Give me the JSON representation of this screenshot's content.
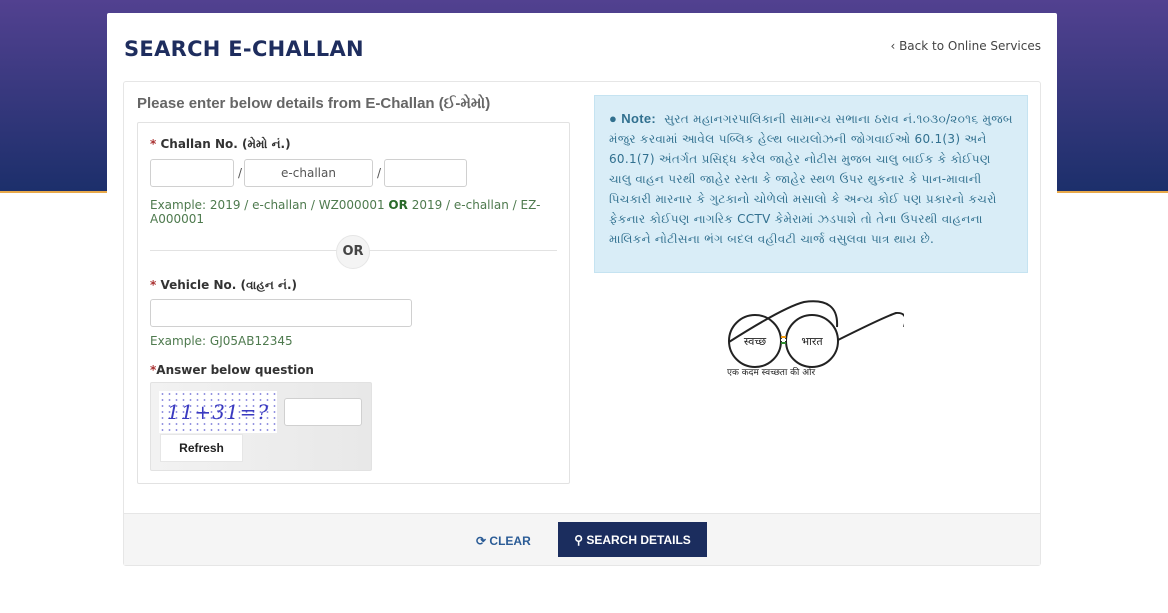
{
  "header": {
    "title": "SEARCH E-CHALLAN",
    "back_link": "‹ Back to Online Services"
  },
  "form": {
    "subtitle": "Please enter below details from E-Challan (ઈ-મેમો)",
    "challan_label": "Challan No. (મેમો નં.)",
    "challan_year_value": "",
    "challan_middle_value": "e-challan",
    "challan_number_value": "",
    "separator": "/",
    "challan_example_prefix": "Example: 2019 / e-challan / WZ000001",
    "challan_example_or": "OR",
    "challan_example_suffix": "2019 / e-challan / EZ-A000001",
    "or_divider": "OR",
    "vehicle_label": "Vehicle No. (વાહન નં.)",
    "vehicle_value": "",
    "vehicle_example": "Example: GJ05AB12345",
    "captcha_label": "Answer below question",
    "captcha_text": "11+31=?",
    "captcha_answer": "",
    "refresh_label": "Refresh",
    "required_mark": "*"
  },
  "note": {
    "label": "Note:",
    "icon": "exclamation-circle-icon",
    "text": "સુરત મહાનગરપાલિકાની સામાન્ય સભાના ઠરાવ નં.૧૦૩૦/૨૦૧૬ મુજબ મંજુર કરવામાં આવેલ પબ્લિક હેલ્થ બાયલોઝની જોગવાઈઓ 60.1(3) અને 60.1(7) અંતર્ગત પ્રસિદ્ધ કરેલ જાહેર નોટીસ મુજબ ચાલુ બાઈક કે કોઈપણ ચાલુ વાહન પરથી જાહેર રસ્તા કે જાહેર સ્થળ ઉપર થુકનાર કે પાન-માવાની પિચકારી મારનાર કે ગુટકાનો ચોળેલો મસાલો કે અન્ય કોઈ પણ પ્રકારનો કચરો ફેકનાર કોઈપણ નાગરિક CCTV કેમેરામાં ઝડપાશે તો તેના ઉપરથી વાહનના માલિકને નોટીસના ભંગ બદલ વહીવટી ચાર્જ વસુલવા પાત્ર થાય છે."
  },
  "logo": {
    "left": "स्वच्छ",
    "right": "भारत",
    "tagline": "एक कदम स्वच्छता की ओर"
  },
  "actions": {
    "clear": "CLEAR",
    "search": "SEARCH DETAILS"
  },
  "colors": {
    "primary": "#1b2d5e",
    "note_bg": "#d9edf7",
    "example_green": "#4e7a4e"
  }
}
